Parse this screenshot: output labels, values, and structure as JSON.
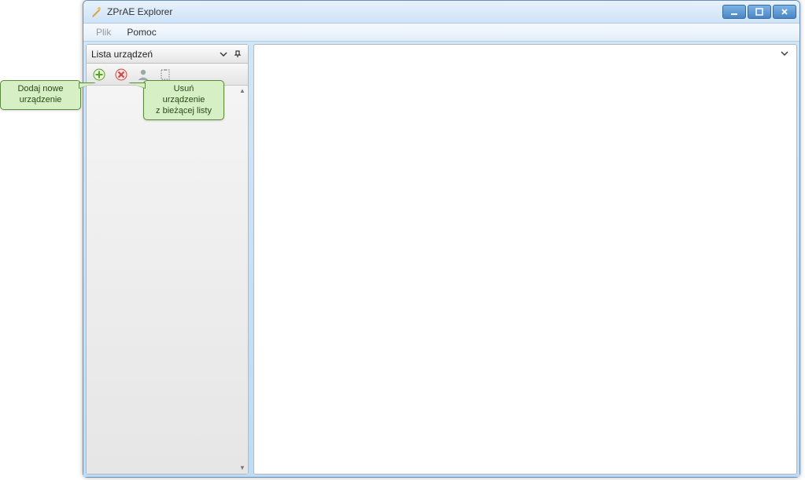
{
  "window": {
    "title": "ZPrAE Explorer"
  },
  "menu": {
    "file": "Plik",
    "help": "Pomoc"
  },
  "sidebar": {
    "title": "Lista urządzeń",
    "toolbar": {
      "add_icon": "plus-icon",
      "delete_icon": "delete-icon",
      "user_icon": "user-icon",
      "clipboard_icon": "clipboard-icon"
    }
  },
  "tooltips": {
    "add_device": "Dodaj nowe\nurządzenie",
    "delete_device": "Usuń urządzenie\nz bieżącej listy"
  }
}
